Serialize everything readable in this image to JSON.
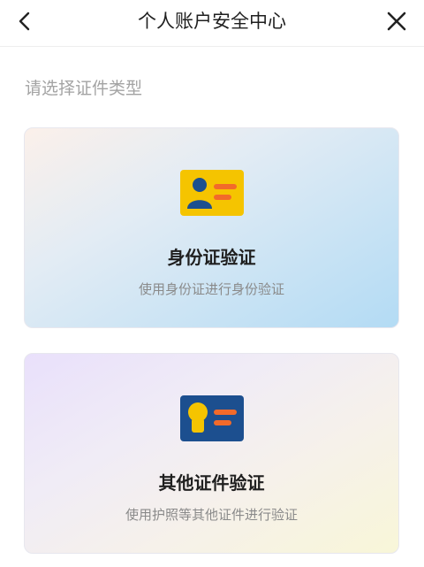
{
  "header": {
    "title": "个人账户安全中心"
  },
  "prompt": "请选择证件类型",
  "cards": [
    {
      "title": "身份证验证",
      "subtitle": "使用身份证进行身份验证",
      "icon": "id-card-icon"
    },
    {
      "title": "其他证件验证",
      "subtitle": "使用护照等其他证件进行验证",
      "icon": "document-card-icon"
    }
  ],
  "colors": {
    "card_icon_yellow": "#f5c400",
    "card_icon_blue": "#1c4f8f",
    "card_icon_orange": "#f26a2a",
    "title_text": "#1f1f1f",
    "muted_text": "#a3a3a3"
  }
}
